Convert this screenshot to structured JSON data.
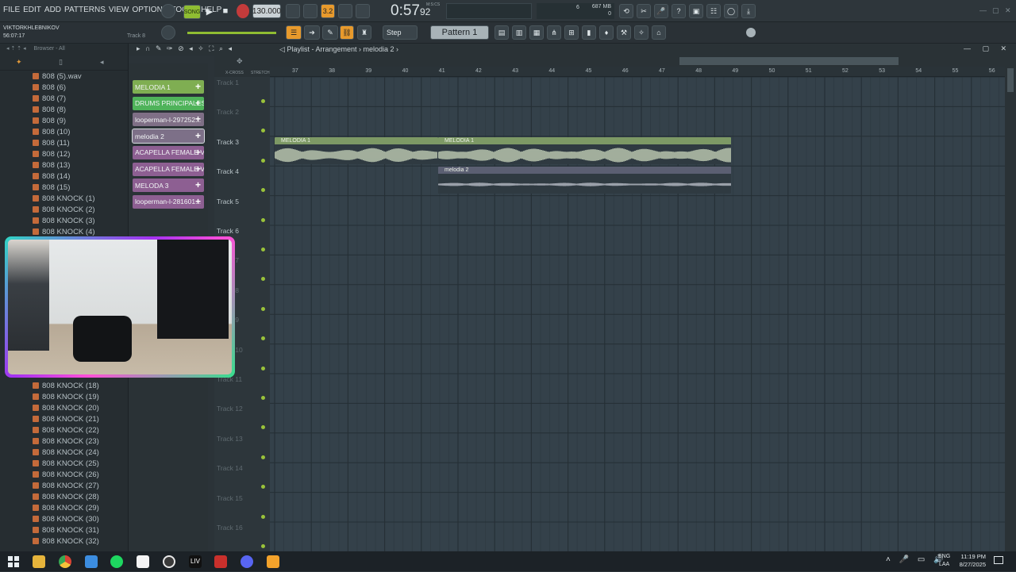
{
  "menu": [
    "FILE",
    "EDIT",
    "ADD",
    "PATTERNS",
    "VIEW",
    "OPTIONS",
    "TOOLS",
    "HELP"
  ],
  "transport": {
    "mode": "SONG",
    "tempo": "130.000",
    "time": "0:57",
    "time_sub": "92",
    "time_units": "M:S:CS",
    "memory": "687 MB",
    "cpu": "6",
    "poly": "0"
  },
  "hint": {
    "user": "VIKTORKHLEBNIKOV",
    "timestamp": "56:07:17",
    "track": "Track 8"
  },
  "toolbar2": {
    "snap": "Step",
    "pattern": "Pattern 1"
  },
  "browser": {
    "title": "Browser - All",
    "items": [
      "808 (5).wav",
      "808 (6)",
      "808 (7)",
      "808 (8)",
      "808 (9)",
      "808 (10)",
      "808 (11)",
      "808 (12)",
      "808 (13)",
      "808 (14)",
      "808 (15)",
      "808 KNOCK (1)",
      "808 KNOCK (2)",
      "808 KNOCK (3)",
      "808 KNOCK (4)"
    ],
    "items_lower": [
      "808 KNOCK (18)",
      "808 KNOCK (19)",
      "808 KNOCK (20)",
      "808 KNOCK (21)",
      "808 KNOCK (22)",
      "808 KNOCK (23)",
      "808 KNOCK (24)",
      "808 KNOCK (25)",
      "808 KNOCK (26)",
      "808 KNOCK (27)",
      "808 KNOCK (28)",
      "808 KNOCK (29)",
      "808 KNOCK (30)",
      "808 KNOCK (31)",
      "808 KNOCK (32)"
    ]
  },
  "channels": [
    {
      "label": "MELODIA 1",
      "color": "#7fae52"
    },
    {
      "label": "DRUMS PRINCIPALES",
      "color": "#4fb35a"
    },
    {
      "label": "looperman-l-297252...",
      "color": "#7f6f86"
    },
    {
      "label": "melodia 2",
      "color": "#7d7088"
    },
    {
      "label": "ACAPELLA FEMALE VO...",
      "color": "#8d5f92"
    },
    {
      "label": "ACAPELLA FEMALE VO...",
      "color": "#8d5f92"
    },
    {
      "label": "MELODA 3",
      "color": "#8d5f92"
    },
    {
      "label": "looperman-l-281601...",
      "color": "#8d5f92"
    }
  ],
  "playlist": {
    "title": "Playlist - Arrangement",
    "pattern": "melodia 2",
    "crossfade": "X-CROSS",
    "stretch": "STRETCH",
    "ruler": [
      "37",
      "38",
      "39",
      "40",
      "41",
      "42",
      "43",
      "44",
      "45",
      "46",
      "47",
      "48",
      "49",
      "50",
      "51",
      "52",
      "53",
      "54",
      "55",
      "56"
    ],
    "tracks": [
      "Track 1",
      "Track 2",
      "Track 3",
      "Track 4",
      "Track 5",
      "Track 6",
      "Track 7",
      "Track 8",
      "Track 9",
      "Track 10",
      "Track 11",
      "Track 12",
      "Track 13",
      "Track 14",
      "Track 15",
      "Track 16"
    ],
    "clips": [
      {
        "label": "MELODIA 1",
        "color": "#7d9965"
      },
      {
        "label": "MELODIA 1",
        "color": "#7d9965"
      },
      {
        "label": "melodia 2",
        "color": "#5b5f72"
      }
    ]
  },
  "taskbar": {
    "lang": "ENG",
    "region": "LAA",
    "time": "11:19 PM",
    "date": "8/27/2025"
  }
}
